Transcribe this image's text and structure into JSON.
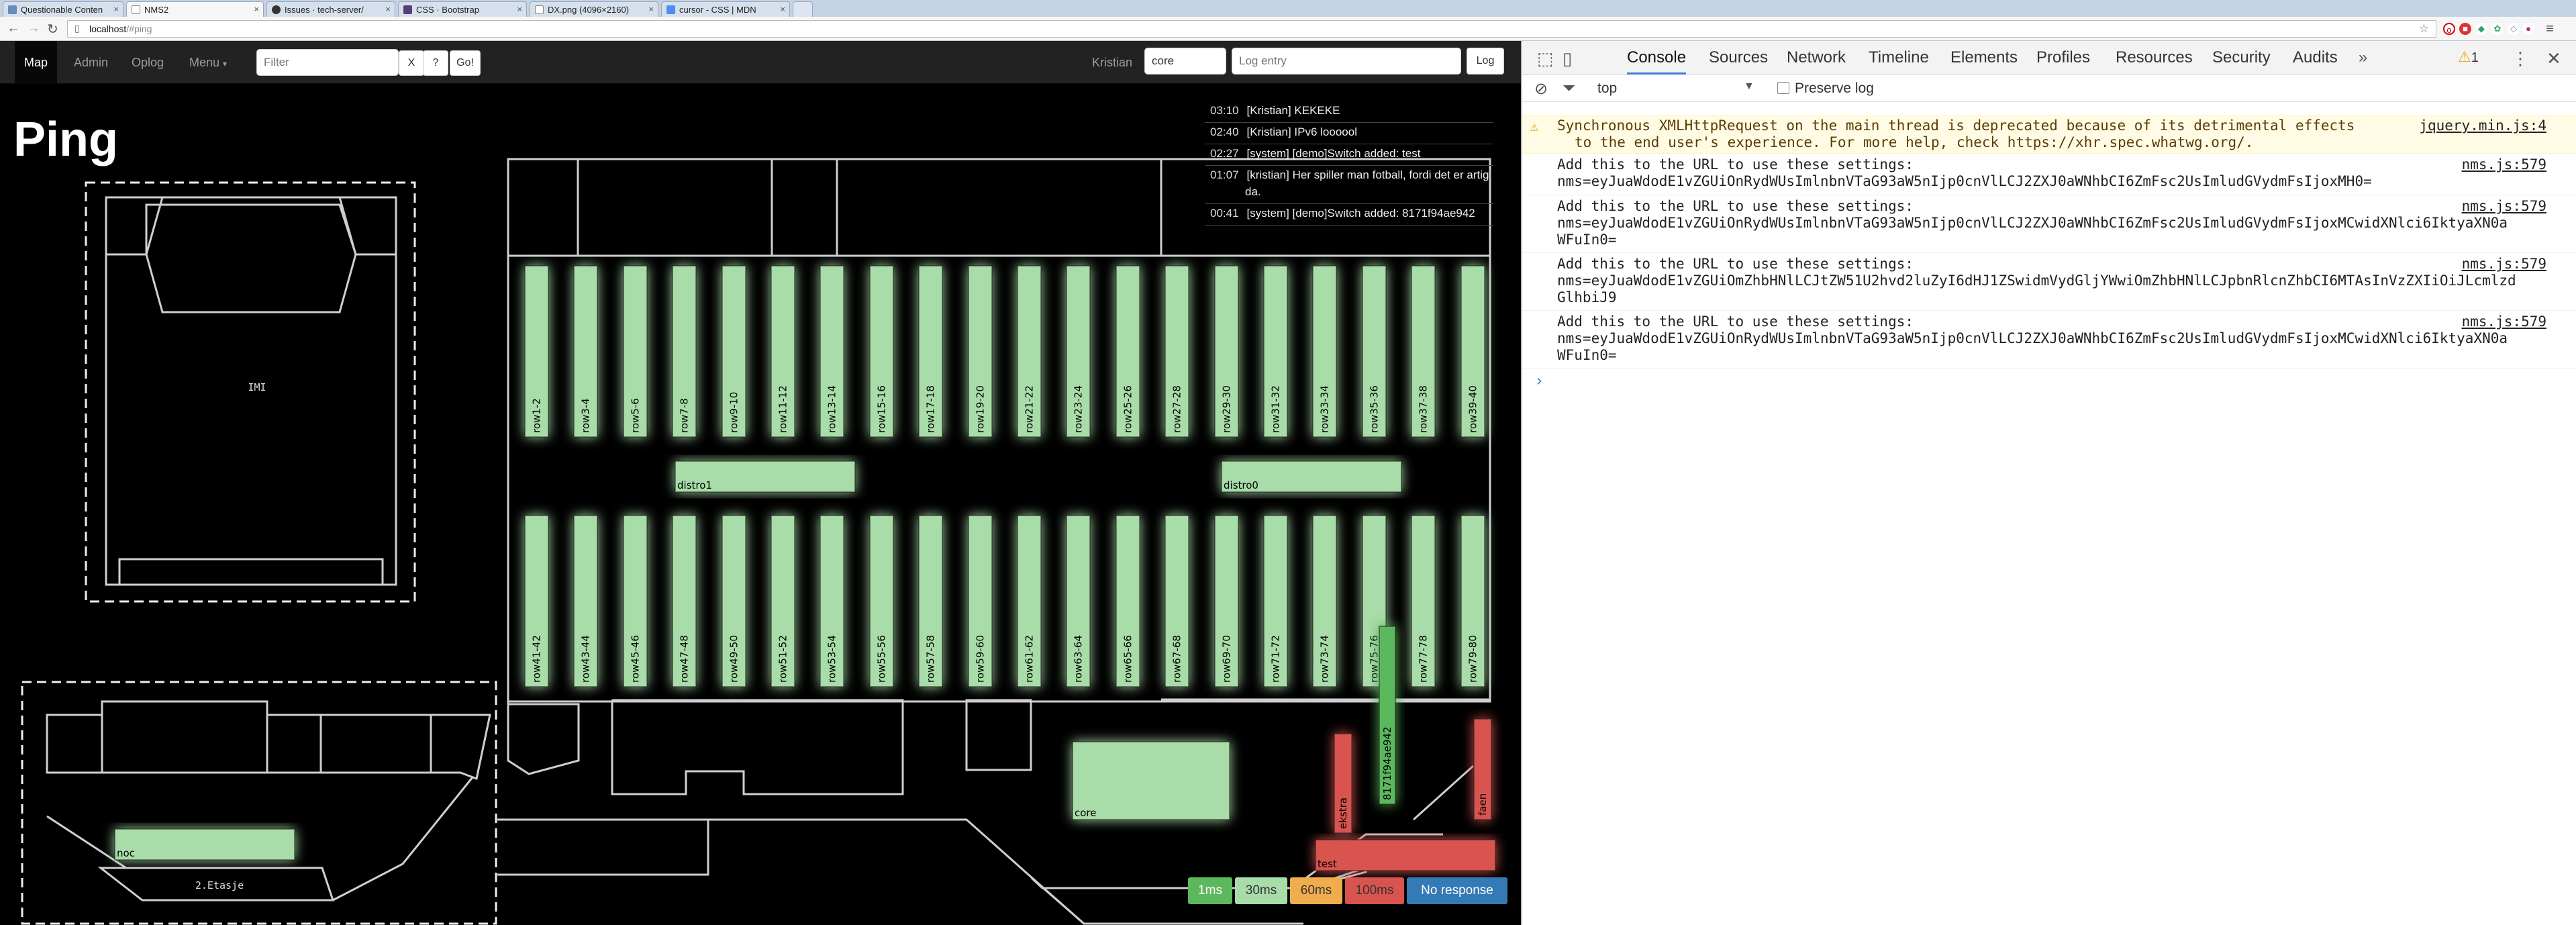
{
  "browser": {
    "tabs": [
      {
        "label": "Questionable Conten",
        "color": "#6a8bbf",
        "active": false
      },
      {
        "label": "NMS2",
        "color": "#ffffff",
        "active": true
      },
      {
        "label": "Issues · tech-server/",
        "color": "#333333",
        "active": false
      },
      {
        "label": "CSS · Bootstrap",
        "color": "#563d7c",
        "active": false
      },
      {
        "label": "DX.png (4096×2160)",
        "color": "#ffffff",
        "active": false
      },
      {
        "label": "cursor - CSS | MDN",
        "color": "#4c8ef2",
        "active": false
      }
    ],
    "url_host": "localhost",
    "url_path": "/#ping",
    "alert_count": "1"
  },
  "navbar": {
    "items": [
      "Map",
      "Admin",
      "Oplog",
      "Menu"
    ],
    "filter_placeholder": "Filter",
    "btn_clear": "X",
    "btn_help": "?",
    "btn_go": "Go!",
    "user": "Kristian",
    "log_user_value": "core",
    "log_entry_placeholder": "Log entry",
    "log_button": "Log"
  },
  "page": {
    "title": "Ping"
  },
  "log": [
    {
      "time": "03:10",
      "text": "[Kristian] KEKEKE"
    },
    {
      "time": "02:40",
      "text": "[Kristian] IPv6 loooool"
    },
    {
      "time": "02:27",
      "text": "[system] [demo]Switch added: test"
    },
    {
      "time": "01:07",
      "text": "[kristian] Her spiller man fotball, fordi det er artig"
    },
    {
      "time": "",
      "text": "da."
    },
    {
      "time": "00:41",
      "text": "[system] [demo]Switch added: 8171f94ae942"
    }
  ],
  "map": {
    "labels": {
      "imi": "IMI",
      "etasje": "2.Etasje",
      "noc": "noc",
      "core": "core",
      "distro1": "distro1",
      "distro0": "distro0",
      "test": "test",
      "ekstra": "ekstra",
      "faen": "faen",
      "demo": "8171f94ae942"
    },
    "top_rows": [
      "row1-2",
      "row3-4",
      "row5-6",
      "row7-8",
      "row9-10",
      "row11-12",
      "row13-14",
      "row15-16",
      "row17-18",
      "row19-20",
      "row21-22",
      "row23-24",
      "row25-26",
      "row27-28",
      "row29-30",
      "row31-32",
      "row33-34",
      "row35-36",
      "row37-38",
      "row39-40"
    ],
    "bottom_rows": [
      "row41-42",
      "row43-44",
      "row45-46",
      "row47-48",
      "row49-50",
      "row51-52",
      "row53-54",
      "row55-56",
      "row57-58",
      "row59-60",
      "row61-62",
      "row63-64",
      "row65-66",
      "row67-68",
      "row69-70",
      "row71-72",
      "row73-74",
      "row75-76",
      "row77-78",
      "row79-80"
    ]
  },
  "legend": [
    {
      "label": "1ms",
      "bg": "#5cb85c",
      "fg": "#ffffff"
    },
    {
      "label": "30ms",
      "bg": "#a8dca8",
      "fg": "#333333"
    },
    {
      "label": "60ms",
      "bg": "#f0ad4e",
      "fg": "#333333"
    },
    {
      "label": "100ms",
      "bg": "#d9534f",
      "fg": "#333333"
    },
    {
      "label": "No response",
      "bg": "#337ab7",
      "fg": "#ffffff"
    }
  ],
  "colors": {
    "switch_ok": "#a8dca8",
    "switch_red": "#d9534f",
    "switch_green": "#5cb85c",
    "glow": "#cfeecf"
  },
  "devtools": {
    "tabs": [
      "Console",
      "Sources",
      "Network",
      "Timeline",
      "Elements",
      "Profiles",
      "Resources",
      "Security",
      "Audits"
    ],
    "warn_count": "1",
    "context": "top",
    "preserve_log": "Preserve log",
    "messages": [
      {
        "type": "warn",
        "lines": [
          "Synchronous XMLHttpRequest on the main thread is deprecated because of its detrimental effects",
          "to the end user's experience. For more help, check https://xhr.spec.whatwg.org/."
        ],
        "source": "jquery.min.js:4"
      },
      {
        "type": "log",
        "lines": [
          "Add this to the URL to use these settings:",
          "nms=eyJuaWdodE1vZGUiOnRydWUsImlnbnVTaG93aW5nIjp0cnVlLCJ2ZXJ0aWNhbCI6ZmFsc2UsImludGVydmFsIjoxMH0="
        ],
        "source": "nms.js:579"
      },
      {
        "type": "log",
        "lines": [
          "Add this to the URL to use these settings:",
          "nms=eyJuaWdodE1vZGUiOnRydWUsImlnbnVTaG93aW5nIjp0cnVlLCJ2ZXJ0aWNhbCI6ZmFsc2UsImludGVydmFsIjoxMCwidXNlci6IktyaXN0a",
          "WFuIn0="
        ],
        "source": "nms.js:579"
      },
      {
        "type": "log",
        "lines": [
          "Add this to the URL to use these settings:",
          "nms=eyJuaWdodE1vZGUiOmZhbHNlLCJtZW51U2hvd2luZyI6dHJ1ZSwidmVydGljYWwiOmZhbHNlLCJpbnRlcnZhbCI6MTAsInVzZXIiOiJLcmlzd",
          "GlhbiJ9"
        ],
        "source": "nms.js:579"
      },
      {
        "type": "log",
        "lines": [
          "Add this to the URL to use these settings:",
          "nms=eyJuaWdodE1vZGUiOnRydWUsImlnbnVTaG93aW5nIjp0cnVlLCJ2ZXJ0aWNhbCI6ZmFsc2UsImludGVydmFsIjoxMCwidXNlci6IktyaXN0a",
          "WFuIn0="
        ],
        "source": "nms.js:579"
      }
    ],
    "prompt": "›"
  }
}
